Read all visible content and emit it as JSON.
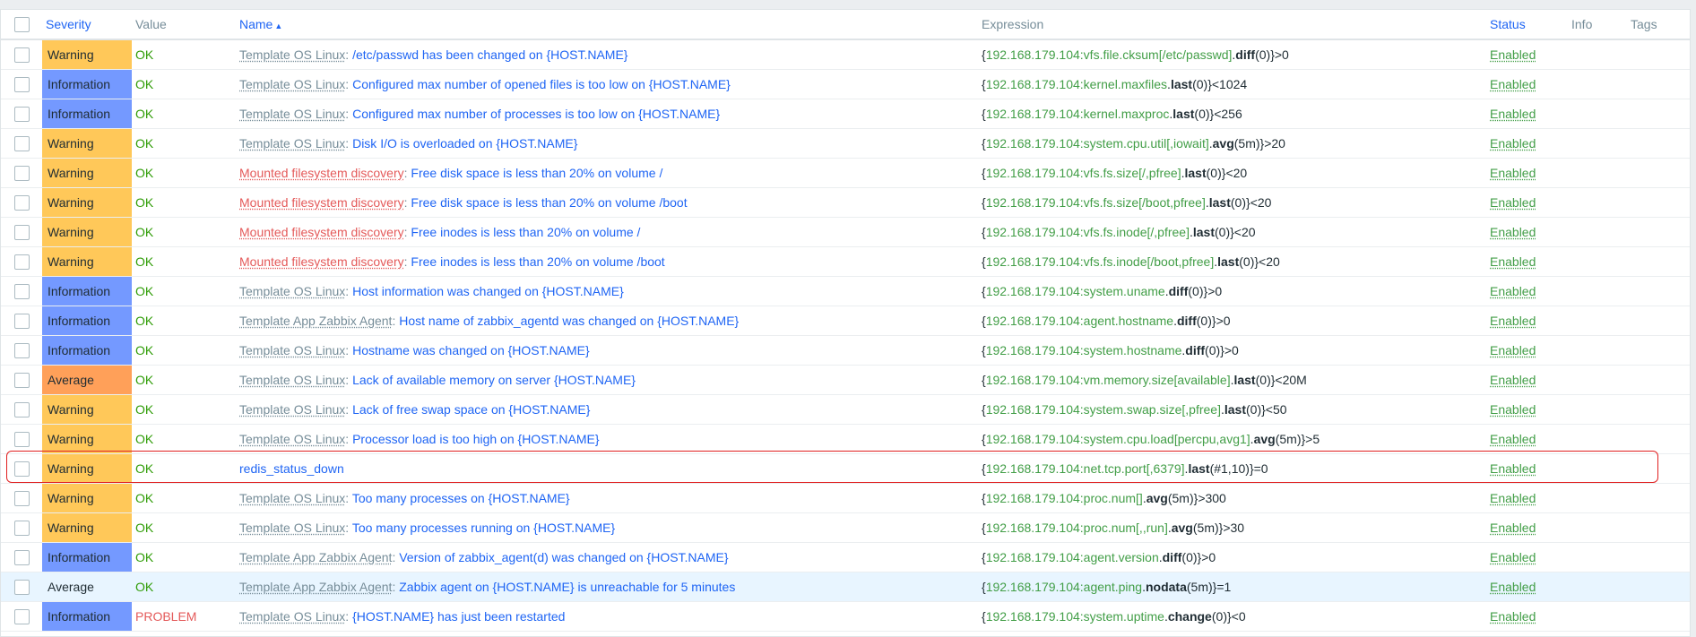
{
  "header": {
    "severity": "Severity",
    "value": "Value",
    "name": "Name",
    "name_sort_icon": "sort-ascending-icon",
    "expression": "Expression",
    "status": "Status",
    "info": "Info",
    "tags": "Tags"
  },
  "colors": {
    "warning": "#ffc859",
    "information": "#7499ff",
    "average": "#ffa059",
    "ok": "#2f9c06",
    "problem": "#e45959",
    "link": "#1f65f4",
    "highlight_box": "#e02020"
  },
  "rows": [
    {
      "severity": "Warning",
      "sev": "warning",
      "value": "OK",
      "prefix": "Template OS Linux",
      "prefix_type": "host",
      "name": "/etc/passwd has been changed on {HOST.NAME}",
      "item": "192.168.179.104:vfs.file.cksum[/etc/passwd]",
      "func": "diff",
      "args": "0",
      "tail": ">0",
      "status": "Enabled"
    },
    {
      "severity": "Information",
      "sev": "information",
      "value": "OK",
      "prefix": "Template OS Linux",
      "prefix_type": "host",
      "name": "Configured max number of opened files is too low on {HOST.NAME}",
      "item": "192.168.179.104:kernel.maxfiles",
      "func": "last",
      "args": "0",
      "tail": "<1024",
      "status": "Enabled"
    },
    {
      "severity": "Information",
      "sev": "information",
      "value": "OK",
      "prefix": "Template OS Linux",
      "prefix_type": "host",
      "name": "Configured max number of processes is too low on {HOST.NAME}",
      "item": "192.168.179.104:kernel.maxproc",
      "func": "last",
      "args": "0",
      "tail": "<256",
      "status": "Enabled"
    },
    {
      "severity": "Warning",
      "sev": "warning",
      "value": "OK",
      "prefix": "Template OS Linux",
      "prefix_type": "host",
      "name": "Disk I/O is overloaded on {HOST.NAME}",
      "item": "192.168.179.104:system.cpu.util[,iowait]",
      "func": "avg",
      "args": "5m",
      "tail": ">20",
      "status": "Enabled"
    },
    {
      "severity": "Warning",
      "sev": "warning",
      "value": "OK",
      "prefix": "Mounted filesystem discovery",
      "prefix_type": "discovery",
      "name": "Free disk space is less than 20% on volume /",
      "item": "192.168.179.104:vfs.fs.size[/,pfree]",
      "func": "last",
      "args": "0",
      "tail": "<20",
      "status": "Enabled"
    },
    {
      "severity": "Warning",
      "sev": "warning",
      "value": "OK",
      "prefix": "Mounted filesystem discovery",
      "prefix_type": "discovery",
      "name": "Free disk space is less than 20% on volume /boot",
      "item": "192.168.179.104:vfs.fs.size[/boot,pfree]",
      "func": "last",
      "args": "0",
      "tail": "<20",
      "status": "Enabled"
    },
    {
      "severity": "Warning",
      "sev": "warning",
      "value": "OK",
      "prefix": "Mounted filesystem discovery",
      "prefix_type": "discovery",
      "name": "Free inodes is less than 20% on volume /",
      "item": "192.168.179.104:vfs.fs.inode[/,pfree]",
      "func": "last",
      "args": "0",
      "tail": "<20",
      "status": "Enabled"
    },
    {
      "severity": "Warning",
      "sev": "warning",
      "value": "OK",
      "prefix": "Mounted filesystem discovery",
      "prefix_type": "discovery",
      "name": "Free inodes is less than 20% on volume /boot",
      "item": "192.168.179.104:vfs.fs.inode[/boot,pfree]",
      "func": "last",
      "args": "0",
      "tail": "<20",
      "status": "Enabled"
    },
    {
      "severity": "Information",
      "sev": "information",
      "value": "OK",
      "prefix": "Template OS Linux",
      "prefix_type": "host",
      "name": "Host information was changed on {HOST.NAME}",
      "item": "192.168.179.104:system.uname",
      "func": "diff",
      "args": "0",
      "tail": ">0",
      "status": "Enabled"
    },
    {
      "severity": "Information",
      "sev": "information",
      "value": "OK",
      "prefix": "Template App Zabbix Agent",
      "prefix_type": "host",
      "name": "Host name of zabbix_agentd was changed on {HOST.NAME}",
      "item": "192.168.179.104:agent.hostname",
      "func": "diff",
      "args": "0",
      "tail": ">0",
      "status": "Enabled"
    },
    {
      "severity": "Information",
      "sev": "information",
      "value": "OK",
      "prefix": "Template OS Linux",
      "prefix_type": "host",
      "name": "Hostname was changed on {HOST.NAME}",
      "item": "192.168.179.104:system.hostname",
      "func": "diff",
      "args": "0",
      "tail": ">0",
      "status": "Enabled"
    },
    {
      "severity": "Average",
      "sev": "average",
      "value": "OK",
      "prefix": "Template OS Linux",
      "prefix_type": "host",
      "name": "Lack of available memory on server {HOST.NAME}",
      "item": "192.168.179.104:vm.memory.size[available]",
      "func": "last",
      "args": "0",
      "tail": "<20M",
      "status": "Enabled"
    },
    {
      "severity": "Warning",
      "sev": "warning",
      "value": "OK",
      "prefix": "Template OS Linux",
      "prefix_type": "host",
      "name": "Lack of free swap space on {HOST.NAME}",
      "item": "192.168.179.104:system.swap.size[,pfree]",
      "func": "last",
      "args": "0",
      "tail": "<50",
      "status": "Enabled"
    },
    {
      "severity": "Warning",
      "sev": "warning",
      "value": "OK",
      "prefix": "Template OS Linux",
      "prefix_type": "host",
      "name": "Processor load is too high on {HOST.NAME}",
      "item": "192.168.179.104:system.cpu.load[percpu,avg1]",
      "func": "avg",
      "args": "5m",
      "tail": ">5",
      "status": "Enabled"
    },
    {
      "severity": "Warning",
      "sev": "warning",
      "value": "OK",
      "prefix": "",
      "prefix_type": "none",
      "name": "redis_status_down",
      "item": "192.168.179.104:net.tcp.port[,6379]",
      "func": "last",
      "args": "#1,10",
      "tail": "=0",
      "status": "Enabled"
    },
    {
      "severity": "Warning",
      "sev": "warning",
      "value": "OK",
      "prefix": "Template OS Linux",
      "prefix_type": "host",
      "name": "Too many processes on {HOST.NAME}",
      "item": "192.168.179.104:proc.num[]",
      "func": "avg",
      "args": "5m",
      "tail": ">300",
      "status": "Enabled"
    },
    {
      "severity": "Warning",
      "sev": "warning",
      "value": "OK",
      "prefix": "Template OS Linux",
      "prefix_type": "host",
      "name": "Too many processes running on {HOST.NAME}",
      "item": "192.168.179.104:proc.num[,,run]",
      "func": "avg",
      "args": "5m",
      "tail": ">30",
      "status": "Enabled"
    },
    {
      "severity": "Information",
      "sev": "information",
      "value": "OK",
      "prefix": "Template App Zabbix Agent",
      "prefix_type": "host",
      "name": "Version of zabbix_agent(d) was changed on {HOST.NAME}",
      "item": "192.168.179.104:agent.version",
      "func": "diff",
      "args": "0",
      "tail": ">0",
      "status": "Enabled"
    },
    {
      "severity": "Average",
      "sev": "average",
      "value": "OK",
      "prefix": "Template App Zabbix Agent",
      "prefix_type": "host",
      "name": "Zabbix agent on {HOST.NAME} is unreachable for 5 minutes",
      "item": "192.168.179.104:agent.ping",
      "func": "nodata",
      "args": "5m",
      "tail": "=1",
      "status": "Enabled",
      "highlight": true
    },
    {
      "severity": "Information",
      "sev": "information",
      "value": "PROBLEM",
      "prefix": "Template OS Linux",
      "prefix_type": "host",
      "name": "{HOST.NAME} has just been restarted",
      "item": "192.168.179.104:system.uptime",
      "func": "change",
      "args": "0",
      "tail": "<0",
      "status": "Enabled"
    }
  ]
}
